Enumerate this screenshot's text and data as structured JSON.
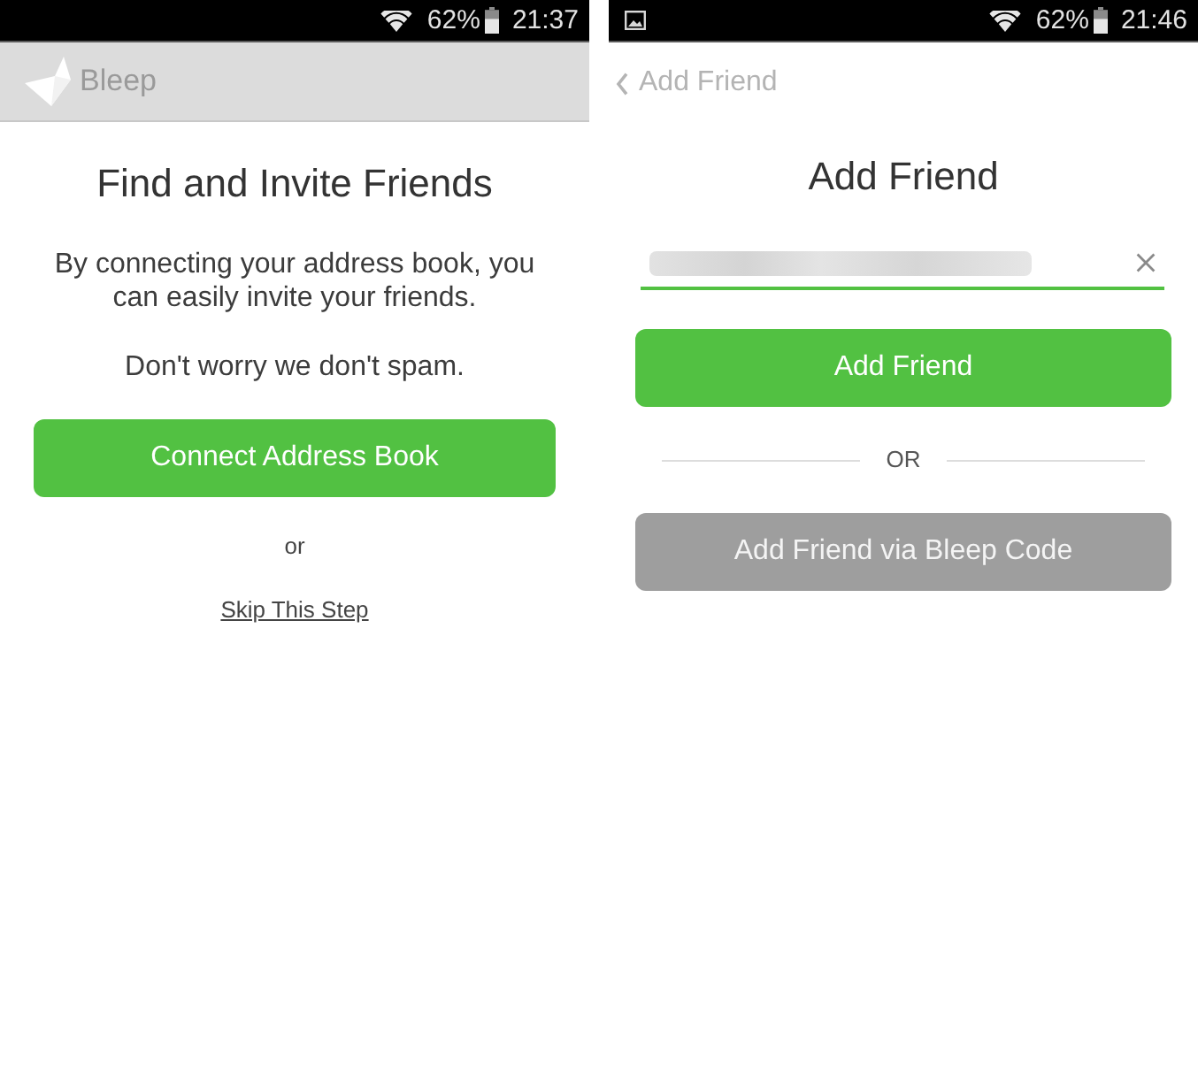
{
  "screens": [
    {
      "kind": "invite",
      "status_bar": {
        "notification": false,
        "battery": "62%",
        "time": "21:37"
      },
      "app_bar": {
        "title": "Bleep"
      },
      "heading": "Find and Invite Friends",
      "message": "By connecting your address book, you can easily invite your friends.",
      "note": "Don't worry we don't spam.",
      "primary_button": "Connect Address Book",
      "separator": "or",
      "skip_link": "Skip This Step"
    },
    {
      "kind": "add_friend",
      "status_bar": {
        "notification": true,
        "battery": "62%",
        "time": "21:46"
      },
      "nav": {
        "back_label": "Add Friend"
      },
      "heading": "Add Friend",
      "field": {
        "focused": true,
        "value_blurred": true
      },
      "primary_button": "Add Friend",
      "separator": "OR",
      "secondary_button": "Add Friend via Bleep Code"
    }
  ]
}
